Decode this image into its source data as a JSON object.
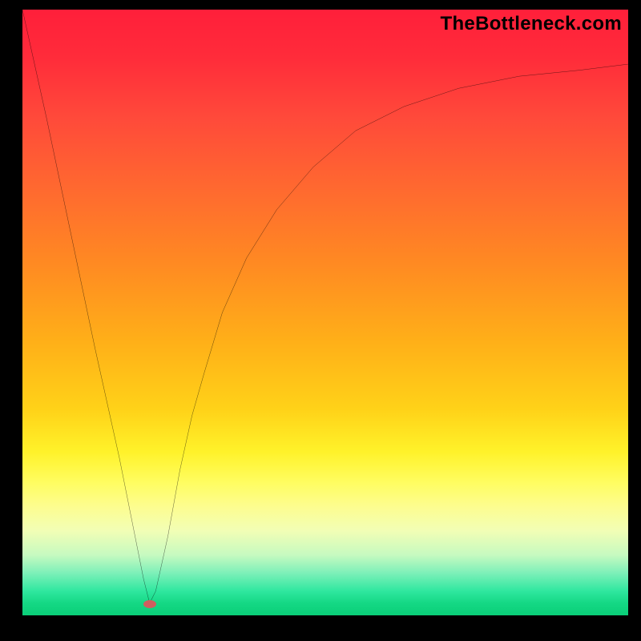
{
  "watermark": "TheBottleneck.com",
  "marker": {
    "x_pct": 21.0,
    "y_pct": 98.2
  },
  "chart_data": {
    "type": "line",
    "title": "",
    "xlabel": "",
    "ylabel": "",
    "xlim": [
      0,
      100
    ],
    "ylim": [
      0,
      100
    ],
    "series": [
      {
        "name": "curve",
        "x": [
          0,
          4,
          8,
          12,
          16,
          18,
          20,
          21,
          22,
          24,
          26,
          28,
          30,
          33,
          37,
          42,
          48,
          55,
          63,
          72,
          82,
          92,
          100
        ],
        "y": [
          100,
          82,
          63,
          44,
          26,
          16,
          6,
          2,
          4,
          13,
          24,
          33,
          40,
          50,
          59,
          67,
          74,
          80,
          84,
          87,
          89,
          90,
          91
        ]
      }
    ],
    "annotations": [
      {
        "type": "marker",
        "x": 21,
        "y": 2,
        "label": ""
      }
    ],
    "background_gradient": {
      "top_color": "#ff1f3a",
      "bottom_color": "#0ace78",
      "description": "vertical red-to-green heat gradient"
    }
  }
}
